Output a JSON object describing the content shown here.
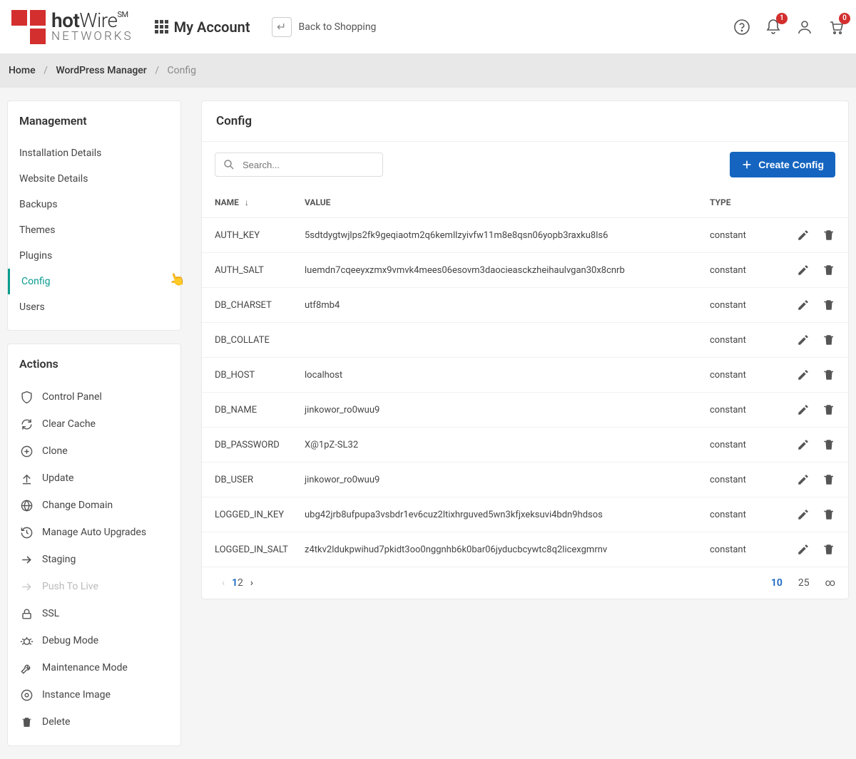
{
  "header": {
    "brand_top": "hotWire",
    "brand_sm": "SM",
    "brand_bottom": "NETWORKS",
    "my_account": "My Account",
    "back_to_shopping": "Back to Shopping",
    "notif_badge": "1",
    "cart_badge": "0"
  },
  "breadcrumb": {
    "home": "Home",
    "wp": "WordPress Manager",
    "current": "Config"
  },
  "sidebar": {
    "management_title": "Management",
    "mgmt_items": [
      "Installation Details",
      "Website Details",
      "Backups",
      "Themes",
      "Plugins",
      "Config",
      "Users"
    ],
    "mgmt_active_index": 5,
    "actions_title": "Actions",
    "actions": [
      {
        "label": "Control Panel",
        "icon": "shield"
      },
      {
        "label": "Clear Cache",
        "icon": "refresh"
      },
      {
        "label": "Clone",
        "icon": "plus-circle"
      },
      {
        "label": "Update",
        "icon": "upload"
      },
      {
        "label": "Change Domain",
        "icon": "globe"
      },
      {
        "label": "Manage Auto Upgrades",
        "icon": "history"
      },
      {
        "label": "Staging",
        "icon": "arrow-right"
      },
      {
        "label": "Push To Live",
        "icon": "arrow-right",
        "disabled": true
      },
      {
        "label": "SSL",
        "icon": "lock"
      },
      {
        "label": "Debug Mode",
        "icon": "bug"
      },
      {
        "label": "Maintenance Mode",
        "icon": "wrench"
      },
      {
        "label": "Instance Image",
        "icon": "disc"
      },
      {
        "label": "Delete",
        "icon": "trash"
      }
    ]
  },
  "main": {
    "title": "Config",
    "search_placeholder": "Search...",
    "create_label": "Create Config",
    "columns": {
      "name": "NAME",
      "value": "VALUE",
      "type": "TYPE"
    },
    "rows": [
      {
        "name": "AUTH_KEY",
        "value": "5sdtdygtwjlps2fk9geqiaotm2q6kemllzyivfw11m8e8qsn06yopb3raxku8ls6",
        "type": "constant"
      },
      {
        "name": "AUTH_SALT",
        "value": "luemdn7cqeeyxzmx9vmvk4mees06esovm3daocieasckzheihaulvgan30x8cnrb",
        "type": "constant"
      },
      {
        "name": "DB_CHARSET",
        "value": "utf8mb4",
        "type": "constant"
      },
      {
        "name": "DB_COLLATE",
        "value": "",
        "type": "constant"
      },
      {
        "name": "DB_HOST",
        "value": "localhost",
        "type": "constant"
      },
      {
        "name": "DB_NAME",
        "value": "jinkowor_ro0wuu9",
        "type": "constant"
      },
      {
        "name": "DB_PASSWORD",
        "value": "X@1pZ-SL32",
        "type": "constant"
      },
      {
        "name": "DB_USER",
        "value": "jinkowor_ro0wuu9",
        "type": "constant"
      },
      {
        "name": "LOGGED_IN_KEY",
        "value": "ubg42jrb8ufpupa3vsbdr1ev6cuz2ltixhrguved5wn3kfjxeksuvi4bdn9hdsos",
        "type": "constant"
      },
      {
        "name": "LOGGED_IN_SALT",
        "value": "z4tkv2ldukpwihud7pkidt3oo0nggnhb6k0bar06jyducbcywtc8q2licexgmrnv",
        "type": "constant"
      }
    ],
    "pagination": {
      "pages": [
        "1",
        "2"
      ],
      "active_page": "1",
      "sizes": [
        "10",
        "25",
        "∞"
      ],
      "active_size": "10"
    }
  }
}
